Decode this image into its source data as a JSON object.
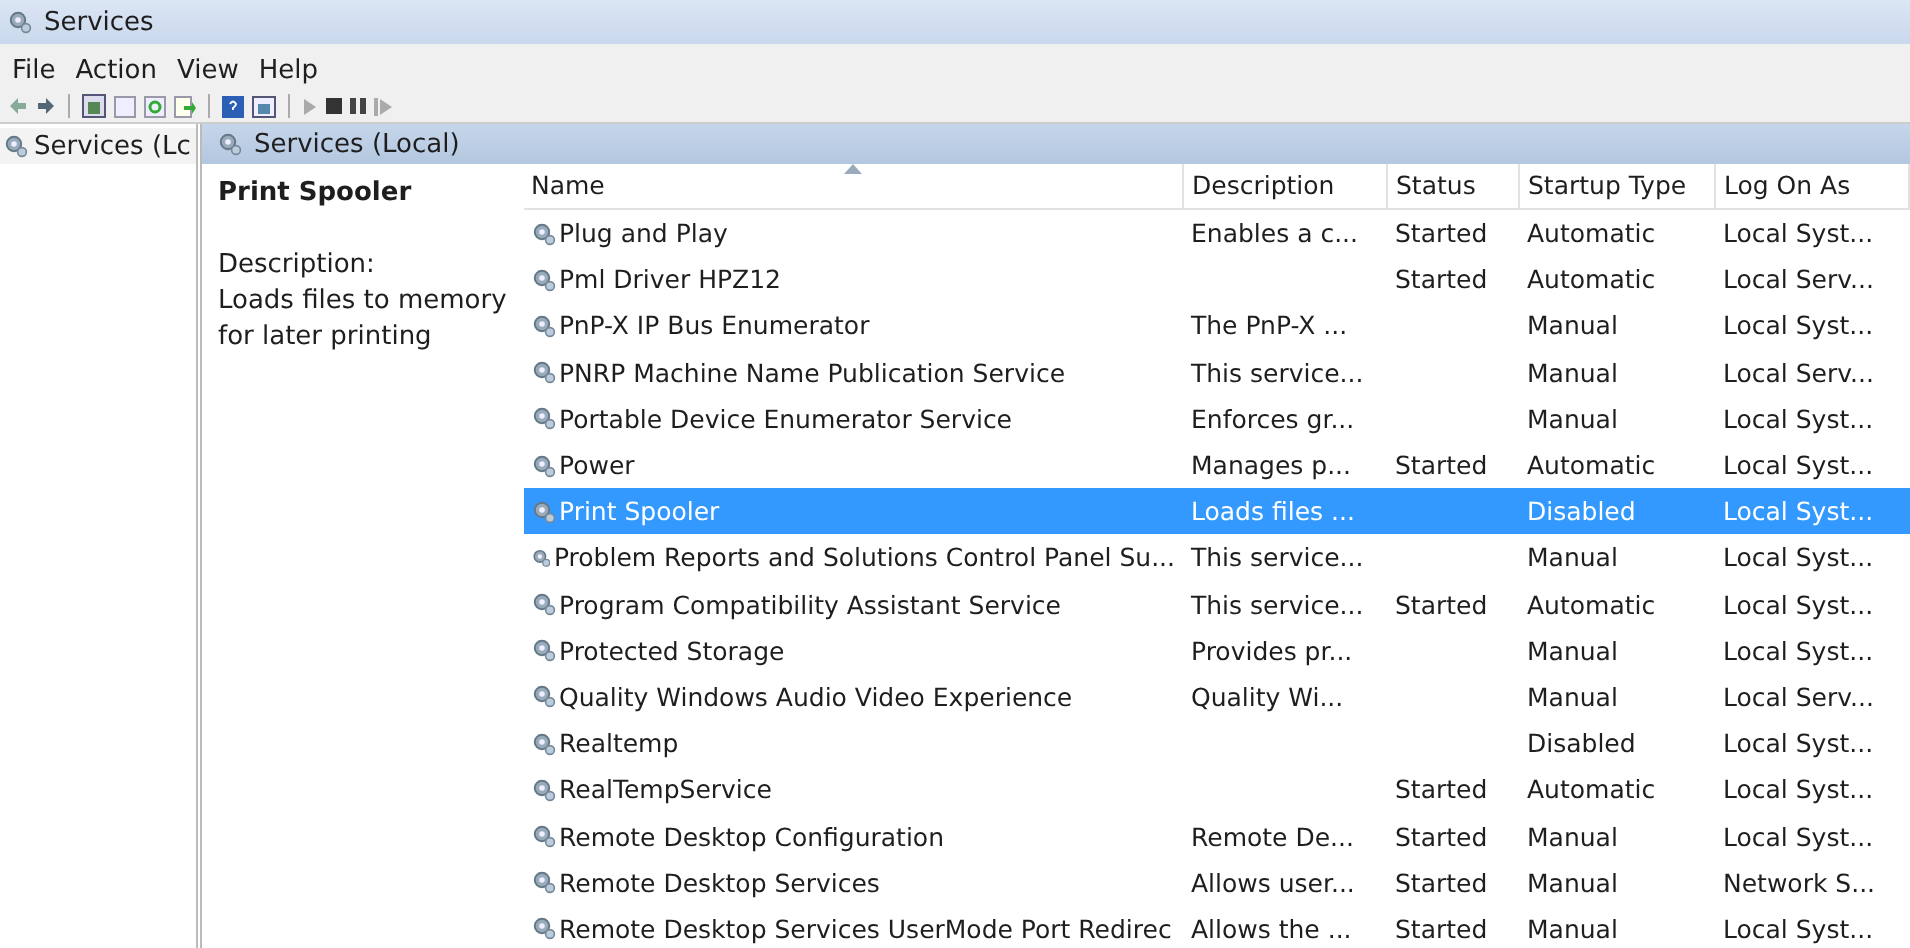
{
  "window": {
    "title": "Services"
  },
  "menu": [
    "File",
    "Action",
    "View",
    "Help"
  ],
  "tree": {
    "items": [
      {
        "label": "Services (Lc",
        "selected": true
      }
    ]
  },
  "panel": {
    "title": "Services (Local)"
  },
  "details": {
    "name": "Print Spooler",
    "label": "Description:",
    "text": "Loads files to memory for later printing"
  },
  "table": {
    "columns": [
      {
        "label": "Name",
        "sorted": true
      },
      {
        "label": "Description",
        "sorted": false
      },
      {
        "label": "Status",
        "sorted": false
      },
      {
        "label": "Startup Type",
        "sorted": false
      },
      {
        "label": "Log On As",
        "sorted": false
      }
    ],
    "rows": [
      {
        "cells": [
          "Plug and Play",
          "Enables a c...",
          "Started",
          "Automatic",
          "Local Syst..."
        ],
        "selected": false
      },
      {
        "cells": [
          "Pml Driver HPZ12",
          "",
          "Started",
          "Automatic",
          "Local Serv..."
        ],
        "selected": false
      },
      {
        "cells": [
          "PnP-X IP Bus Enumerator",
          "The PnP-X ...",
          "",
          "Manual",
          "Local Syst..."
        ],
        "selected": false
      },
      {
        "cells": [
          "PNRP Machine Name Publication Service",
          "This service...",
          "",
          "Manual",
          "Local Serv..."
        ],
        "selected": false
      },
      {
        "cells": [
          "Portable Device Enumerator Service",
          "Enforces gr...",
          "",
          "Manual",
          "Local Syst..."
        ],
        "selected": false
      },
      {
        "cells": [
          "Power",
          "Manages p...",
          "Started",
          "Automatic",
          "Local Syst..."
        ],
        "selected": false
      },
      {
        "cells": [
          "Print Spooler",
          "Loads files ...",
          "",
          "Disabled",
          "Local Syst..."
        ],
        "selected": true
      },
      {
        "cells": [
          "Problem Reports and Solutions Control Panel Su...",
          "This service...",
          "",
          "Manual",
          "Local Syst..."
        ],
        "selected": false
      },
      {
        "cells": [
          "Program Compatibility Assistant Service",
          "This service...",
          "Started",
          "Automatic",
          "Local Syst..."
        ],
        "selected": false
      },
      {
        "cells": [
          "Protected Storage",
          "Provides pr...",
          "",
          "Manual",
          "Local Syst..."
        ],
        "selected": false
      },
      {
        "cells": [
          "Quality Windows Audio Video Experience",
          "Quality Wi...",
          "",
          "Manual",
          "Local Serv..."
        ],
        "selected": false
      },
      {
        "cells": [
          "Realtemp",
          "",
          "",
          "Disabled",
          "Local Syst..."
        ],
        "selected": false
      },
      {
        "cells": [
          "RealTempService",
          "",
          "Started",
          "Automatic",
          "Local Syst..."
        ],
        "selected": false
      },
      {
        "cells": [
          "Remote Desktop Configuration",
          "Remote De...",
          "Started",
          "Manual",
          "Local Syst..."
        ],
        "selected": false
      },
      {
        "cells": [
          "Remote Desktop Services",
          "Allows user...",
          "Started",
          "Manual",
          "Network S..."
        ],
        "selected": false
      },
      {
        "cells": [
          "Remote Desktop Services UserMode Port Redirec",
          "Allows the ...",
          "Started",
          "Manual",
          "Local Syst..."
        ],
        "selected": false
      }
    ]
  }
}
